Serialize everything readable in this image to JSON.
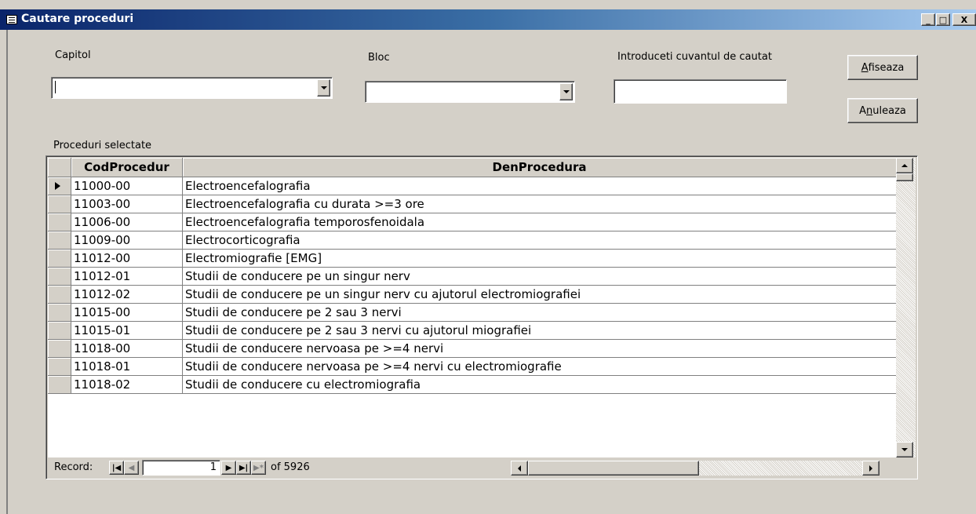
{
  "window": {
    "title": "Cautare proceduri",
    "minimize_label": "_",
    "maximize_label": "□",
    "close_label": "X"
  },
  "form": {
    "capitol_label": "Capitol",
    "capitol_value": "",
    "bloc_label": "Bloc",
    "bloc_value": "",
    "search_label": "Introduceti cuvantul de cautat",
    "search_value": "",
    "afiseaza_label_underlined": "A",
    "afiseaza_label_rest": "fiseaza",
    "anuleaza_label_first": "A",
    "anuleaza_label_underlined": "n",
    "anuleaza_label_rest": "uleaza",
    "results_label": "Proceduri selectate"
  },
  "grid": {
    "columns": [
      "CodProcedur",
      "DenProcedura"
    ],
    "rows": [
      {
        "cod": "11000-00",
        "den": "Electroencefalografia"
      },
      {
        "cod": "11003-00",
        "den": "Electroencefalografia cu durata >=3 ore"
      },
      {
        "cod": "11006-00",
        "den": "Electroencefalografia temporosfenoidala"
      },
      {
        "cod": "11009-00",
        "den": "Electrocorticografia"
      },
      {
        "cod": "11012-00",
        "den": "Electromiografie [EMG]"
      },
      {
        "cod": "11012-01",
        "den": "Studii de conducere pe un singur nerv"
      },
      {
        "cod": "11012-02",
        "den": "Studii de conducere pe un singur nerv cu ajutorul electromiografiei"
      },
      {
        "cod": "11015-00",
        "den": "Studii de conducere pe 2 sau 3 nervi"
      },
      {
        "cod": "11015-01",
        "den": "Studii de conducere pe 2 sau 3 nervi cu ajutorul miografiei"
      },
      {
        "cod": "11018-00",
        "den": "Studii de conducere nervoasa pe >=4 nervi"
      },
      {
        "cod": "11018-01",
        "den": "Studii de conducere nervoasa pe >=4 nervi cu electromiografie"
      },
      {
        "cod": "11018-02",
        "den": "Studii de conducere cu electromiografia"
      }
    ],
    "selected_row": 0
  },
  "navigator": {
    "record_label": "Record:",
    "current_record": "1",
    "of_text": "of 5926",
    "first_icon": "first-record-icon",
    "prev_icon": "previous-record-icon",
    "next_icon": "next-record-icon",
    "last_icon": "last-record-icon",
    "new_icon": "new-record-icon"
  }
}
